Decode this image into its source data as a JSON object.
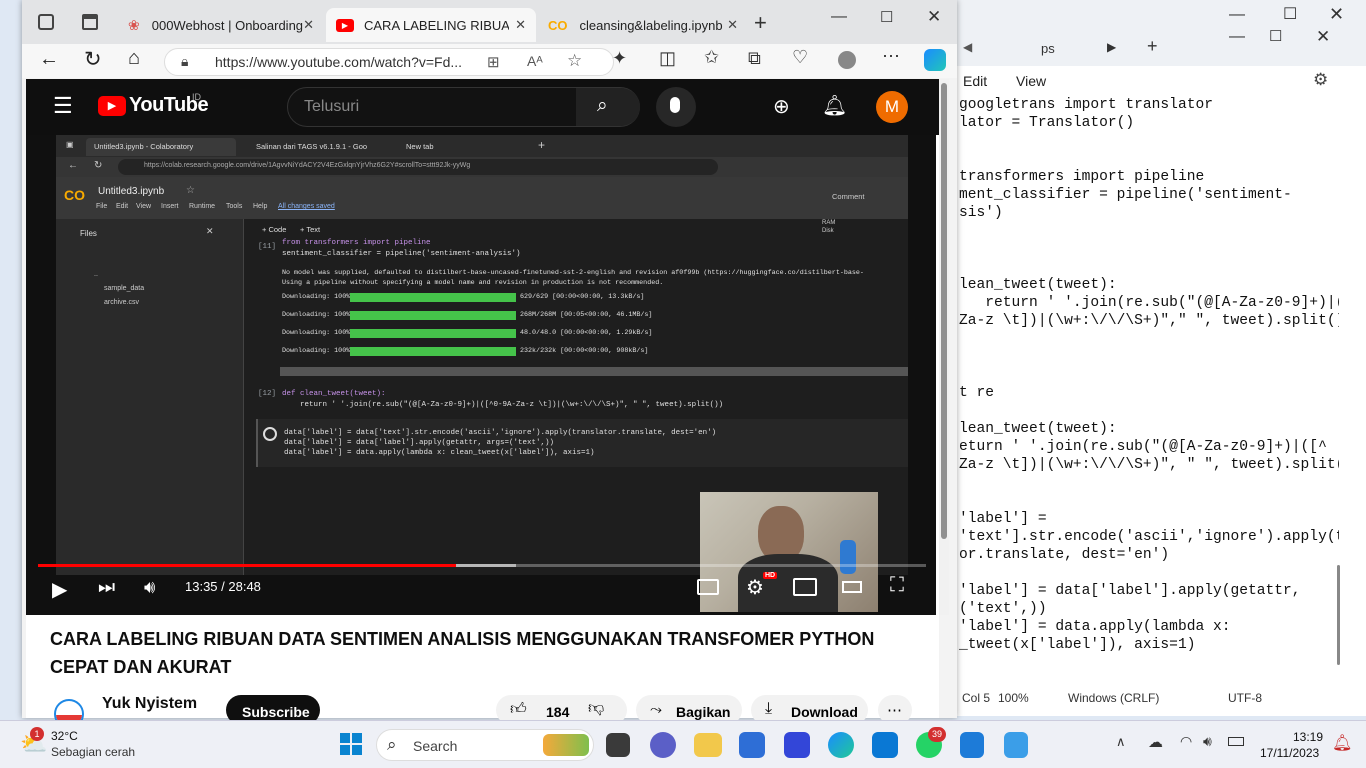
{
  "browser": {
    "tabs": [
      {
        "title": "000Webhost | Onboarding"
      },
      {
        "title": "CARA LABELING RIBUAN DATA"
      },
      {
        "title": "cleansing&labeling.ipynb -"
      }
    ],
    "url": "https://www.youtube.com/watch?v=Fd..."
  },
  "youtube": {
    "logo": "YouTube",
    "country": "ID",
    "search_placeholder": "Telusuri",
    "avatar": "M",
    "time": "13:35 / 28:48",
    "progress_fraction": 0.471,
    "video_title": "CARA LABELING RIBUAN DATA SENTIMEN ANALISIS MENGGUNAKAN TRANSFOMER PYTHON CEPAT DAN AKURAT",
    "channel": "Yuk Nyistem",
    "subscribe": "Subscribe",
    "likes": "184",
    "share": "Bagikan",
    "download": "Download",
    "hd_badge": "HD"
  },
  "colab": {
    "tabs": [
      "Untitled3.ipynb - Colaboratory",
      "Salinan dari TAGS v6.1.9.1 - Goo",
      "New tab"
    ],
    "url": "https://colab.research.google.com/drive/1AgvvNiYdACY2V4EzGxlqnYjrVhz6G2Y#scrollTo=sttt92Jk-yyWg",
    "notebook": "Untitled3.ipynb",
    "menu": [
      "File",
      "Edit",
      "View",
      "Insert",
      "Runtime",
      "Tools",
      "Help",
      "All changes saved"
    ],
    "comment": "Comment",
    "files": "Files",
    "file_items": [
      "..",
      "sample_data",
      "archive.csv"
    ],
    "code_btn": "+ Code",
    "text_btn": "+ Text",
    "ram": "RAM",
    "disk": "Disk",
    "cell11_num": "[11]",
    "cell11_l1": "from transformers import pipeline",
    "cell11_l2": "sentiment_classifier = pipeline('sentiment-analysis')",
    "warn1": "No model was supplied, defaulted to distilbert-base-uncased-finetuned-sst-2-english and revision af0f99b (https://huggingface.co/distilbert-base-",
    "warn2": "Using a pipeline without specifying a model name and revision in production is not recommended.",
    "downloads": [
      {
        "label": "Downloading: 100%",
        "info": "629/629 [00:00<00:00, 13.3kB/s]"
      },
      {
        "label": "Downloading: 100%",
        "info": "268M/268M [00:05<00:00, 46.1MB/s]"
      },
      {
        "label": "Downloading: 100%",
        "info": "48.0/48.0 [00:00<00:00, 1.29kB/s]"
      },
      {
        "label": "Downloading: 100%",
        "info": "232k/232k [00:00<00:00, 908kB/s]"
      }
    ],
    "cell12_num": "[12]",
    "cell12_l1": "def clean_tweet(tweet):",
    "cell12_l2": "    return ' '.join(re.sub(\"(@[A-Za-z0-9]+)|([^0-9A-Za-z \\t])|(\\w+:\\/\\/\\S+)\", \" \", tweet).split())",
    "cell13_l1": "data['label'] = data['text'].str.encode('ascii','ignore').apply(translator.translate, dest='en')",
    "cell13_l2": "data['label'] = data['label'].apply(getattr, args=('text',))",
    "cell13_l3": "data['label'] = data.apply(lambda x:  clean_tweet(x['label']), axis=1)"
  },
  "notepad": {
    "tab": "ps",
    "menu": [
      "Edit",
      "View"
    ],
    "lines": [
      "googletrans import translator",
      "lator = Translator()",
      "",
      "",
      "transformers import pipeline",
      "ment_classifier = pipeline('sentiment-",
      "sis')",
      "",
      "",
      "",
      "lean_tweet(tweet):",
      "   return ' '.join(re.sub(\"(@[A-Za-z0-9]+)|([^",
      "Za-z \\t])|(\\w+:\\/\\/\\S+)\",\" \", tweet).split())",
      "",
      "",
      "",
      "t re",
      "",
      "lean_tweet(tweet):",
      "eturn ' '.join(re.sub(\"(@[A-Za-z0-9]+)|([^",
      "Za-z \\t])|(\\w+:\\/\\/\\S+)\", \" \", tweet).split())",
      "",
      "",
      "'label'] =",
      "'text'].str.encode('ascii','ignore').apply(tra",
      "or.translate, dest='en')",
      "",
      "'label'] = data['label'].apply(getattr,",
      "('text',))",
      "'label'] = data.apply(lambda x:",
      "_tweet(x['label']), axis=1)"
    ],
    "status": {
      "pos": "Col 5",
      "zoom": "100%",
      "eol": "Windows (CRLF)",
      "enc": "UTF-8"
    }
  },
  "taskbar": {
    "weather_temp": "32°C",
    "weather_desc": "Sebagian cerah",
    "weather_badge": "1",
    "search": "Search",
    "whatsapp_badge": "39",
    "time": "13:19",
    "date": "17/11/2023"
  }
}
